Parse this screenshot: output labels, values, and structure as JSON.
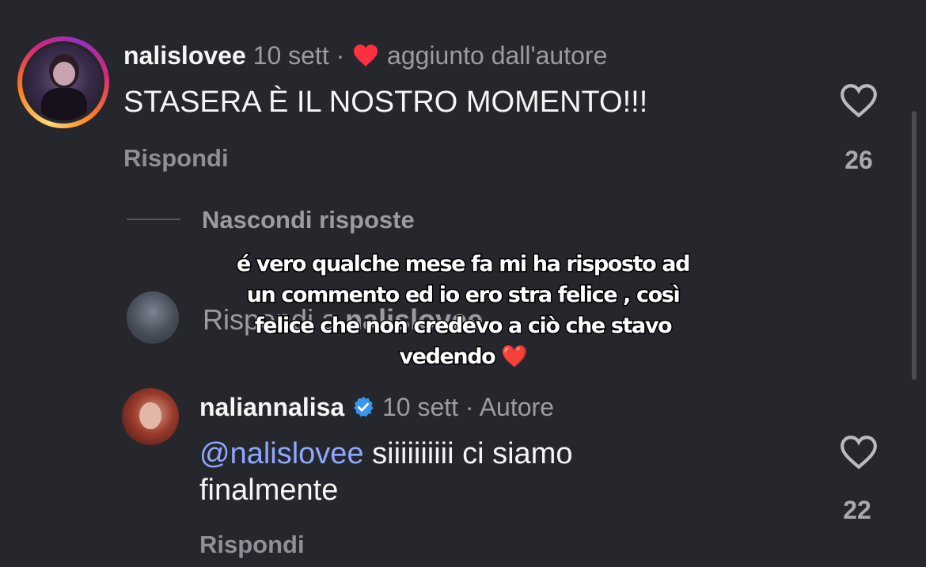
{
  "comment": {
    "username": "nalislovee",
    "time": "10 sett",
    "separator": "·",
    "author_liked_label": "aggiunto dall'autore",
    "text": "STASERA È IL NOSTRO MOMENTO!!!",
    "reply_label": "Rispondi",
    "like_count": "26"
  },
  "hide_replies_label": "Nascondi risposte",
  "reply_prompt": {
    "prefix": "Rispondi a",
    "username": "nalislovee"
  },
  "reply": {
    "username": "naliannalisa",
    "time": "10 sett",
    "separator": "·",
    "badge": "Autore",
    "mention": "@nalislovee",
    "text_line1": " siiiiiiiiii ci siamo",
    "text_line2": "finalmente",
    "reply_label": "Rispondi",
    "like_count": "22"
  },
  "overlay": {
    "line1": "é vero qualche mese fa mi ha risposto ad",
    "line2": "un commento ed io ero stra felice , così",
    "line3": "felice che non credevo a ciò che stavo",
    "line4": "vedendo",
    "emoji": "❤️"
  },
  "colors": {
    "background": "#26272c",
    "like_red": "#ff3040",
    "verified_blue": "#3797f0",
    "mention_blue": "#8ea7ff"
  }
}
